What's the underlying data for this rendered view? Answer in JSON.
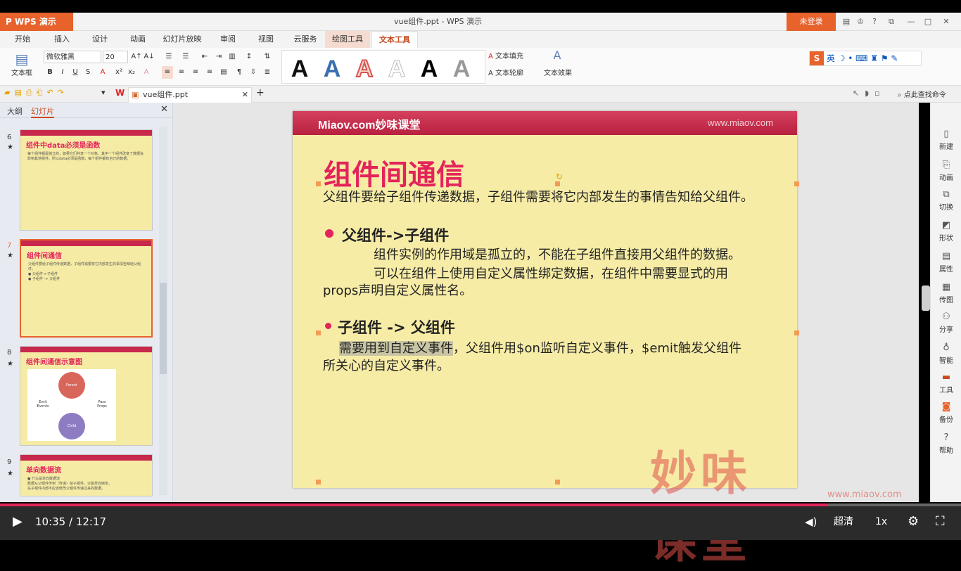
{
  "app": {
    "name": "WPS 演示",
    "window_title": "vue组件.ppt - WPS 演示",
    "login": "未登录"
  },
  "tabs": [
    "开始",
    "插入",
    "设计",
    "动画",
    "幻灯片放映",
    "审阅",
    "视图",
    "云服务",
    "绘图工具",
    "文本工具"
  ],
  "ribbon": {
    "textbox": "文本框",
    "font_name": "微软雅黑",
    "font_size": "20",
    "text_fill": "文本填充",
    "text_outline": "文本轮廓",
    "text_effect": "文本效果",
    "art_letter": "A"
  },
  "ime": "英",
  "quickbar": {
    "file_tab": "vue组件.ppt",
    "search": "点此查找命令"
  },
  "panel": {
    "tab_outline": "大纲",
    "tab_slides": "幻灯片"
  },
  "thumbnails": [
    {
      "num": "6",
      "title": "组件中data必须是函数",
      "body": "每个组件都是独立的，如果它们共享一个对象，其中一个组件改变了数据会影响其他组件。所以data必须是函数，每个组件都有自己的数据。"
    },
    {
      "num": "7",
      "title": "组件间通信",
      "body": "父组件要给子组件传递数据，子组件需要将它内部发生的事情告知给父组件。\n● 父组件->子组件\n● 子组件 -> 父组件"
    },
    {
      "num": "8",
      "title": "组件间通信示意图",
      "diagram": {
        "parent": "Parent",
        "child": "Child",
        "left": "Emit Events",
        "right": "Pass Props"
      }
    },
    {
      "num": "9",
      "title": "单向数据流",
      "body": "● 什么是单向数据流\n数据从父组件传到（传递）给子组件，只能单向绑定。\n在子组件内部不应该修改父组件传递过来的数据。"
    }
  ],
  "slide": {
    "logo": "Miaov.com妙味课堂",
    "url": "www.miaov.com",
    "title": "组件间通信",
    "intro": "父组件要给子组件传递数据，子组件需要将它内部发生的事情告知给父组件。",
    "h1": "父组件->子组件",
    "p1": "组件实例的作用域是孤立的，不能在子组件直接用父组件的数据。",
    "p2a": "可以在组件上使用自定义属性绑定数据，在组件中需要显式的用",
    "p2b": "props声明自定义属性名。",
    "h2": "子组件 -> 父组件",
    "p3_hl": "需要用到自定义事件",
    "p3_rest": "，父组件用$on监听自定义事件，$emit触发父组件",
    "p3b": "所关心的自定义事件。",
    "watermark": "妙味课堂",
    "watermark_url": "www.miaov.com"
  },
  "rightbar": [
    "新建",
    "动画",
    "切换",
    "形状",
    "属性",
    "传图",
    "分享",
    "智能",
    "工具",
    "备份",
    "帮助"
  ],
  "player": {
    "time": "10:35 / 12:17",
    "quality": "超清",
    "speed": "1x",
    "progress": 0.862
  }
}
